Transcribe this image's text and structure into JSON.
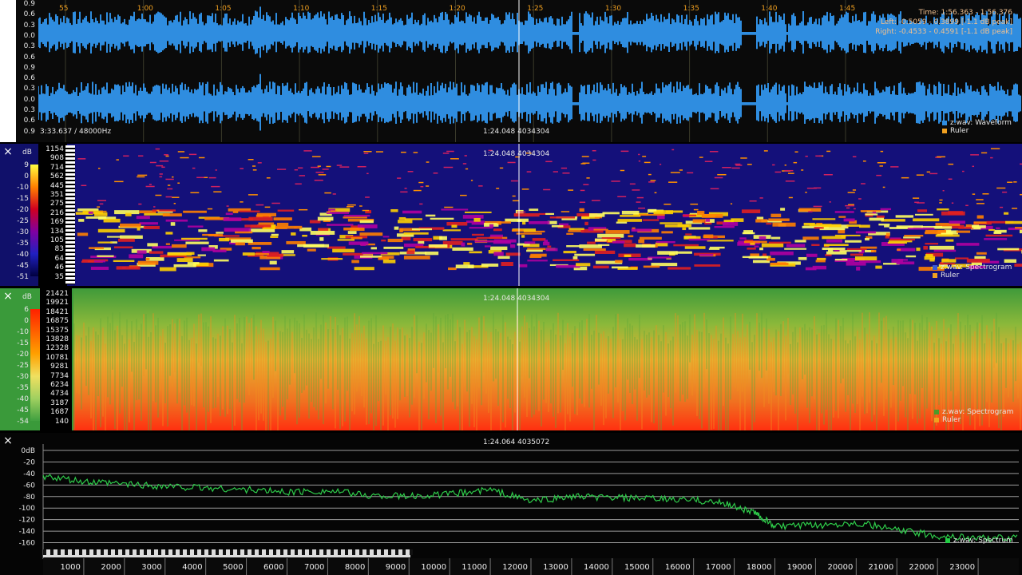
{
  "waveform": {
    "time_ticks": [
      "55",
      "1:00",
      "1:05",
      "1:10",
      "1:15",
      "1:20",
      "1:25",
      "1:30",
      "1:35",
      "1:40",
      "1:45"
    ],
    "amp_labels": [
      "0.9",
      "0.6",
      "0.3",
      "0.0",
      "0.3",
      "0.6",
      "0.9",
      "0.6",
      "0.3",
      "0.0",
      "0.3",
      "0.6",
      "0.9"
    ],
    "status": "3:33.637 / 48000Hz",
    "cursor": "1:24.048  4034304",
    "info_lines": [
      "Time: 1:56.363 - 1:56.376",
      "Left: -0.5059 - 0.3899 [-1.1 dB peak]",
      "Right: -0.4533 - 0.4591 [-1.1 dB peak]"
    ],
    "legend": [
      {
        "label": "z.wav: Waveform",
        "color": "#2f8de0"
      },
      {
        "label": "Ruler",
        "color": "#f0a020"
      }
    ]
  },
  "spec1": {
    "db_unit": "dB",
    "db_scale": [
      "9",
      "0",
      "-10",
      "-15",
      "-20",
      "-25",
      "-30",
      "-35",
      "-40",
      "-45",
      "-51"
    ],
    "freq_labels": [
      "1154",
      "908",
      "714",
      "562",
      "445",
      "351",
      "275",
      "216",
      "169",
      "134",
      "105",
      "83",
      "64",
      "46",
      "35"
    ],
    "cursor": "1:24.048  4034304",
    "legend": [
      {
        "label": "z.wav: Spectrogram",
        "color": "#3a5ad8"
      },
      {
        "label": "Ruler",
        "color": "#f0a020"
      }
    ]
  },
  "spec2": {
    "db_unit": "dB",
    "db_scale": [
      "6",
      "0",
      "-10",
      "-15",
      "-20",
      "-25",
      "-30",
      "-35",
      "-40",
      "-45",
      "-54"
    ],
    "freq_labels": [
      "21421",
      "19921",
      "18421",
      "16875",
      "15375",
      "13828",
      "12328",
      "10781",
      "9281",
      "7734",
      "6234",
      "4734",
      "3187",
      "1687",
      "140"
    ],
    "cursor": "1:24.048  4034304",
    "legend": [
      {
        "label": "z.wav: Spectrogram",
        "color": "#4a9a2a"
      },
      {
        "label": "Ruler",
        "color": "#f0a020"
      }
    ]
  },
  "spectrum": {
    "cursor": "1:24.064  4035072",
    "legend": [
      {
        "label": "z.wav: Spectrum",
        "color": "#22cc44"
      }
    ],
    "chart_data": {
      "type": "line",
      "y_labels": [
        "0dB",
        "-20",
        "-40",
        "-60",
        "-80",
        "-100",
        "-120",
        "-140",
        "-160"
      ],
      "x_ticks": [
        "1000",
        "2000",
        "3000",
        "4000",
        "5000",
        "6000",
        "7000",
        "8000",
        "9000",
        "10000",
        "11000",
        "12000",
        "13000",
        "14000",
        "15000",
        "16000",
        "17000",
        "18000",
        "19000",
        "20000",
        "21000",
        "22000",
        "23000"
      ],
      "x_range": [
        0,
        24000
      ],
      "y_range": [
        -180,
        0
      ],
      "series": [
        {
          "color": "#2ecc4a",
          "x": [
            0,
            1000,
            2000,
            3000,
            4000,
            5000,
            6000,
            7000,
            8000,
            9000,
            10000,
            11000,
            12000,
            13000,
            14000,
            15000,
            16000,
            16800,
            17500,
            18000,
            19000,
            20000,
            21000,
            22000,
            23000,
            24000
          ],
          "y": [
            -45,
            -55,
            -58,
            -62,
            -65,
            -68,
            -72,
            -70,
            -78,
            -80,
            -76,
            -68,
            -88,
            -80,
            -82,
            -84,
            -86,
            -92,
            -108,
            -132,
            -130,
            -125,
            -138,
            -148,
            -152,
            -152
          ]
        }
      ]
    }
  },
  "closes": {
    "c1": "×",
    "c2": "×",
    "c3": "×"
  }
}
